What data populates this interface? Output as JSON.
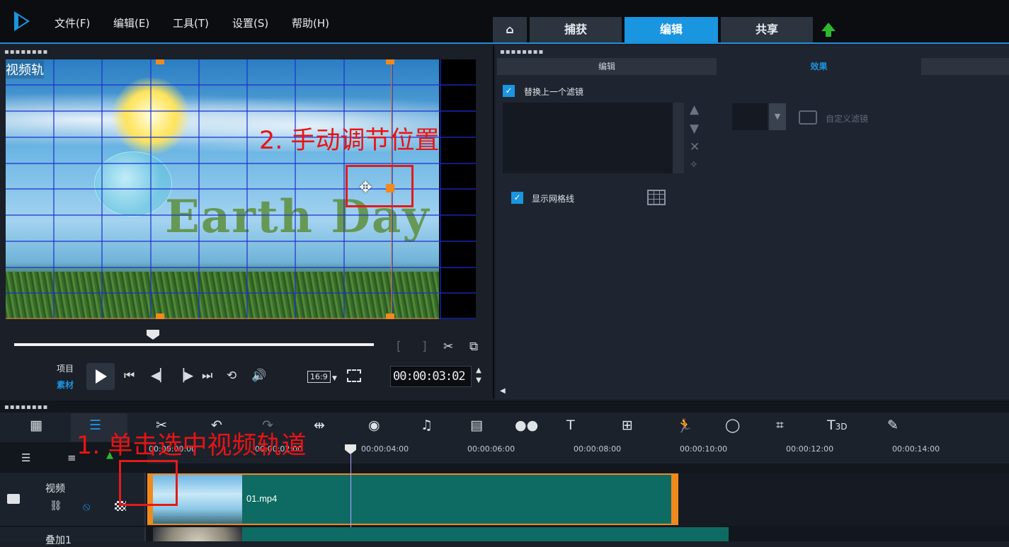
{
  "menu": [
    "文件(F)",
    "编辑(E)",
    "工具(T)",
    "设置(S)",
    "帮助(H)"
  ],
  "tabs": {
    "capture": "捕获",
    "edit": "编辑",
    "share": "共享"
  },
  "preview": {
    "track_label": "视频轨",
    "mode_project": "项目",
    "mode_clip": "素材",
    "aspect": "16:9",
    "timecode": "00:00:03:02",
    "overlay_text": "Earth Day"
  },
  "right_panel": {
    "tab_edit": "编辑",
    "tab_effect": "效果",
    "replace_filter": "替换上一个滤镜",
    "custom_filter": "自定义滤镜",
    "show_grid": "显示网格线"
  },
  "timeline": {
    "ruler": [
      "00:00:00:00",
      "00:00:02:00",
      "00:00:04:00",
      "00:00:06:00",
      "00:00:08:00",
      "00:00:10:00",
      "00:00:12:00",
      "00:00:14:00"
    ],
    "video_track_label": "视频",
    "overlay_track_label": "叠加1",
    "clip_name": "01.mp4"
  },
  "annotations": {
    "step1": "1. 单击选中视频轨道",
    "step2": "2. 手动调节位置"
  },
  "colors": {
    "accent": "#1a95e0",
    "annotation": "#e21b1b",
    "clip": "#0e6b63"
  }
}
